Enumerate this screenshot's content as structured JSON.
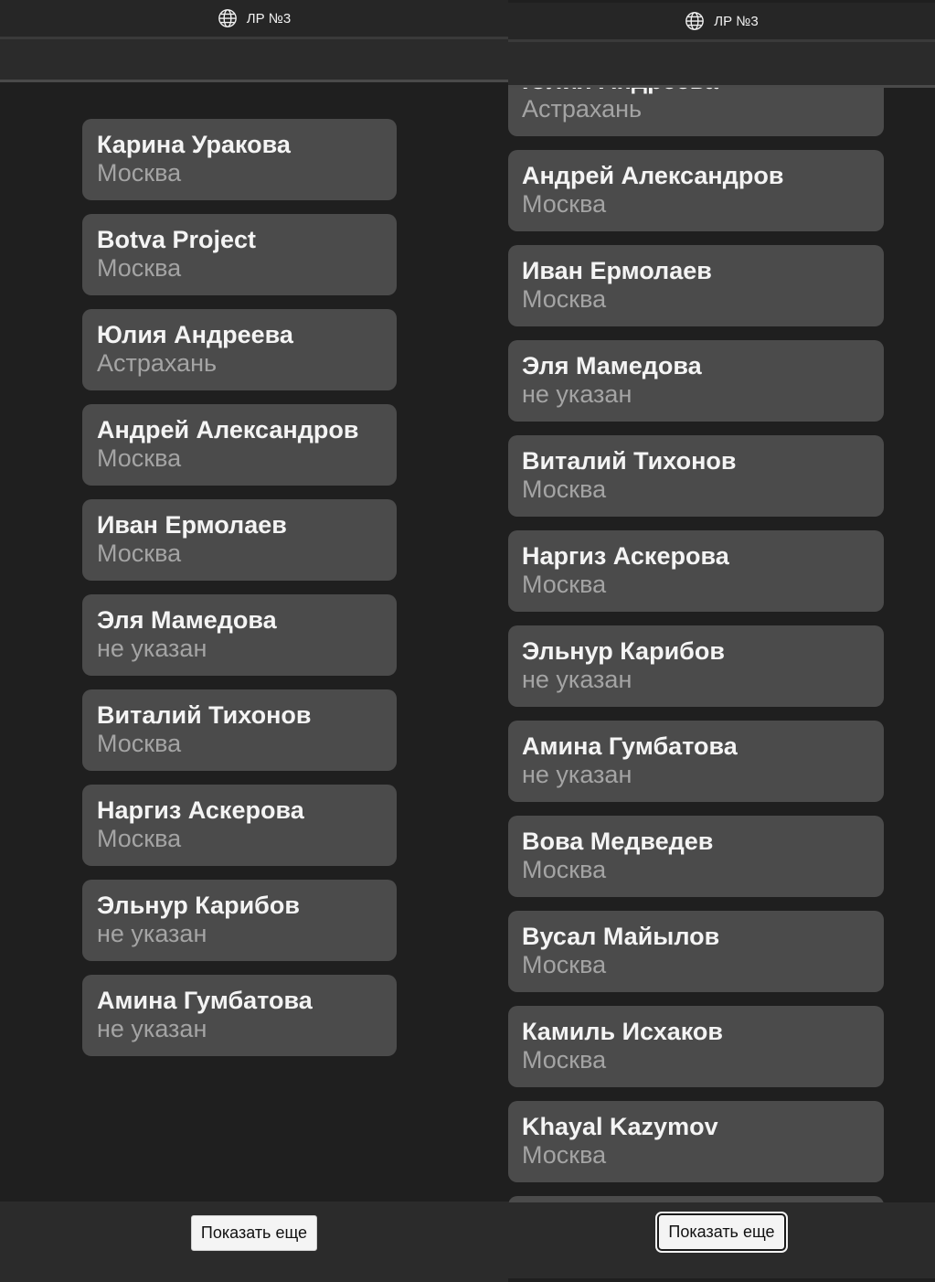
{
  "left_panel": {
    "title": "ЛР №3",
    "cards": [
      {
        "name": "Карина Уракова",
        "city": "Москва"
      },
      {
        "name": "Botva Project",
        "city": "Москва"
      },
      {
        "name": "Юлия Андреева",
        "city": "Астрахань"
      },
      {
        "name": "Андрей Александров",
        "city": "Москва"
      },
      {
        "name": "Иван Ермолаев",
        "city": "Москва"
      },
      {
        "name": "Эля Мамедова",
        "city": "не указан"
      },
      {
        "name": "Виталий Тихонов",
        "city": "Москва"
      },
      {
        "name": "Наргиз Аскерова",
        "city": "Москва"
      },
      {
        "name": "Эльнур Карибов",
        "city": "не указан"
      },
      {
        "name": "Амина Гумбатова",
        "city": "не указан"
      }
    ],
    "show_more_label": "Показать еще"
  },
  "right_panel": {
    "title": "ЛР №3",
    "cards": [
      {
        "name": "Юлия Андреева",
        "city": "Астрахань"
      },
      {
        "name": "Андрей Александров",
        "city": "Москва"
      },
      {
        "name": "Иван Ермолаев",
        "city": "Москва"
      },
      {
        "name": "Эля Мамедова",
        "city": "не указан"
      },
      {
        "name": "Виталий Тихонов",
        "city": "Москва"
      },
      {
        "name": "Наргиз Аскерова",
        "city": "Москва"
      },
      {
        "name": "Эльнур Карибов",
        "city": "не указан"
      },
      {
        "name": "Амина Гумбатова",
        "city": "не указан"
      },
      {
        "name": "Вова Медведев",
        "city": "Москва"
      },
      {
        "name": "Вусал Майылов",
        "city": "Москва"
      },
      {
        "name": "Камиль Исхаков",
        "city": "Москва"
      },
      {
        "name": "Khayal Kazymov",
        "city": "Москва"
      },
      {
        "name": "",
        "city": ""
      }
    ],
    "show_more_label": "Показать еще"
  },
  "icons": {
    "title_icon": "globe-icon"
  },
  "colors": {
    "background": "#1f1f1f",
    "card": "#4b4b4b",
    "name_text": "#f4f4f4",
    "city_text": "#a4a4a4"
  }
}
